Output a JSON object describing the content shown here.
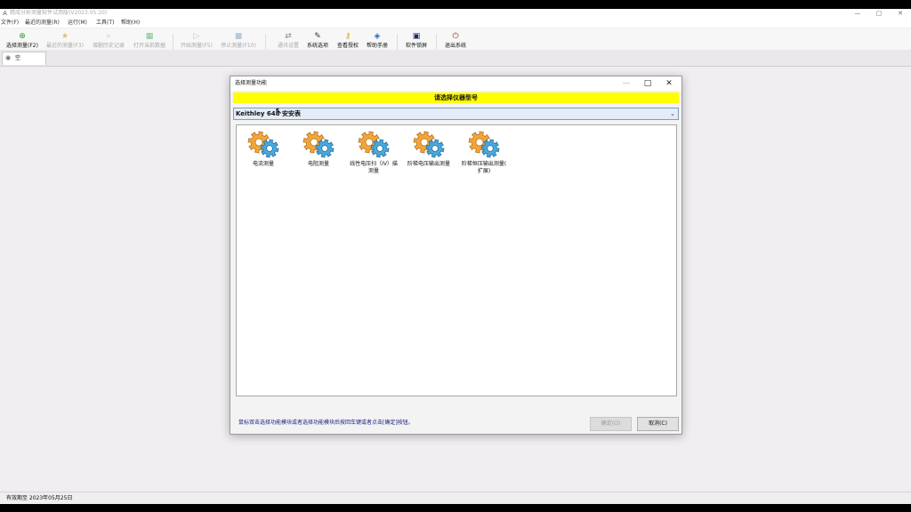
{
  "window": {
    "app_icon": "A",
    "title": "精成分析测量软件试用版(V2023.05.10)",
    "controls": {
      "minimize": "—",
      "maximize": "▢",
      "close": "✕"
    }
  },
  "menu": [
    "文件(F)",
    "最近的测量(R)",
    "运行(M)",
    "工具(T)",
    "帮助(H)"
  ],
  "toolbar": [
    {
      "label": "选择测量(F2)",
      "icon": "add-green-icon",
      "glyph": "⊕",
      "color": "#2e9b2e",
      "enabled": true
    },
    {
      "label": "最近的测量(F3)",
      "icon": "star-icon",
      "glyph": "★",
      "color": "#d8c36a",
      "enabled": false
    },
    {
      "label": "增删历史记录",
      "icon": "search-icon",
      "glyph": "⌕",
      "color": "#999999",
      "enabled": false
    },
    {
      "label": "打开当前数据",
      "icon": "excel-icon",
      "glyph": "▦",
      "color": "#3a9a4a",
      "enabled": false
    },
    {
      "label": "开始测量(F5)",
      "icon": "play-icon",
      "glyph": "▷",
      "color": "#6f9ee0",
      "enabled": false
    },
    {
      "label": "停止测量(F10)",
      "icon": "stop-icon",
      "glyph": "■",
      "color": "#9fb9e0",
      "enabled": false
    },
    {
      "label": "通讯设置",
      "icon": "link-icon",
      "glyph": "⇄",
      "color": "#888888",
      "enabled": false
    },
    {
      "label": "系统选项",
      "icon": "wrench-icon",
      "glyph": "✎",
      "color": "#333333",
      "enabled": true
    },
    {
      "label": "查看授权",
      "icon": "key-icon",
      "glyph": "⚷",
      "color": "#e0a020",
      "enabled": true
    },
    {
      "label": "帮助手册",
      "icon": "help-book-icon",
      "glyph": "◈",
      "color": "#2a6bd0",
      "enabled": true
    },
    {
      "label": "软件锁屏",
      "icon": "monitor-lock-icon",
      "glyph": "▣",
      "color": "#1a2a6a",
      "enabled": true
    },
    {
      "label": "退出系统",
      "icon": "exit-icon",
      "glyph": "⏻",
      "color": "#cc2222",
      "enabled": true
    }
  ],
  "tab": {
    "label": "空",
    "icon": "eye-icon",
    "glyph": "◉"
  },
  "status": {
    "text": "有效期至 2023年05月25日"
  },
  "dialog": {
    "title": "选择测量功能",
    "controls": {
      "minimize": "—",
      "maximize": "□",
      "close": "✕"
    },
    "banner": "请选择仪器型号",
    "instrument": {
      "value": "Keithley 648 安安表",
      "arrow": "⌄"
    },
    "cursor_glyph": "↖",
    "functions": [
      {
        "label": "电流测量"
      },
      {
        "label": "电阻测量"
      },
      {
        "label": "线性电压扫（IV）描\n测量"
      },
      {
        "label": "阶梯电压输出测量"
      },
      {
        "label": "阶梯恒压输出测量(\n扩展)"
      }
    ],
    "hint": "鼠标双击选择功能模块或者选择功能模块后按回车键或者点击[确定]按钮。",
    "ok_label": "确定(O)",
    "cancel_label": "取消(C)"
  },
  "colors": {
    "banner": "#ffff00",
    "gear_orange": "#f2a63a",
    "gear_blue": "#4aa8de",
    "hint": "#1a237e"
  }
}
